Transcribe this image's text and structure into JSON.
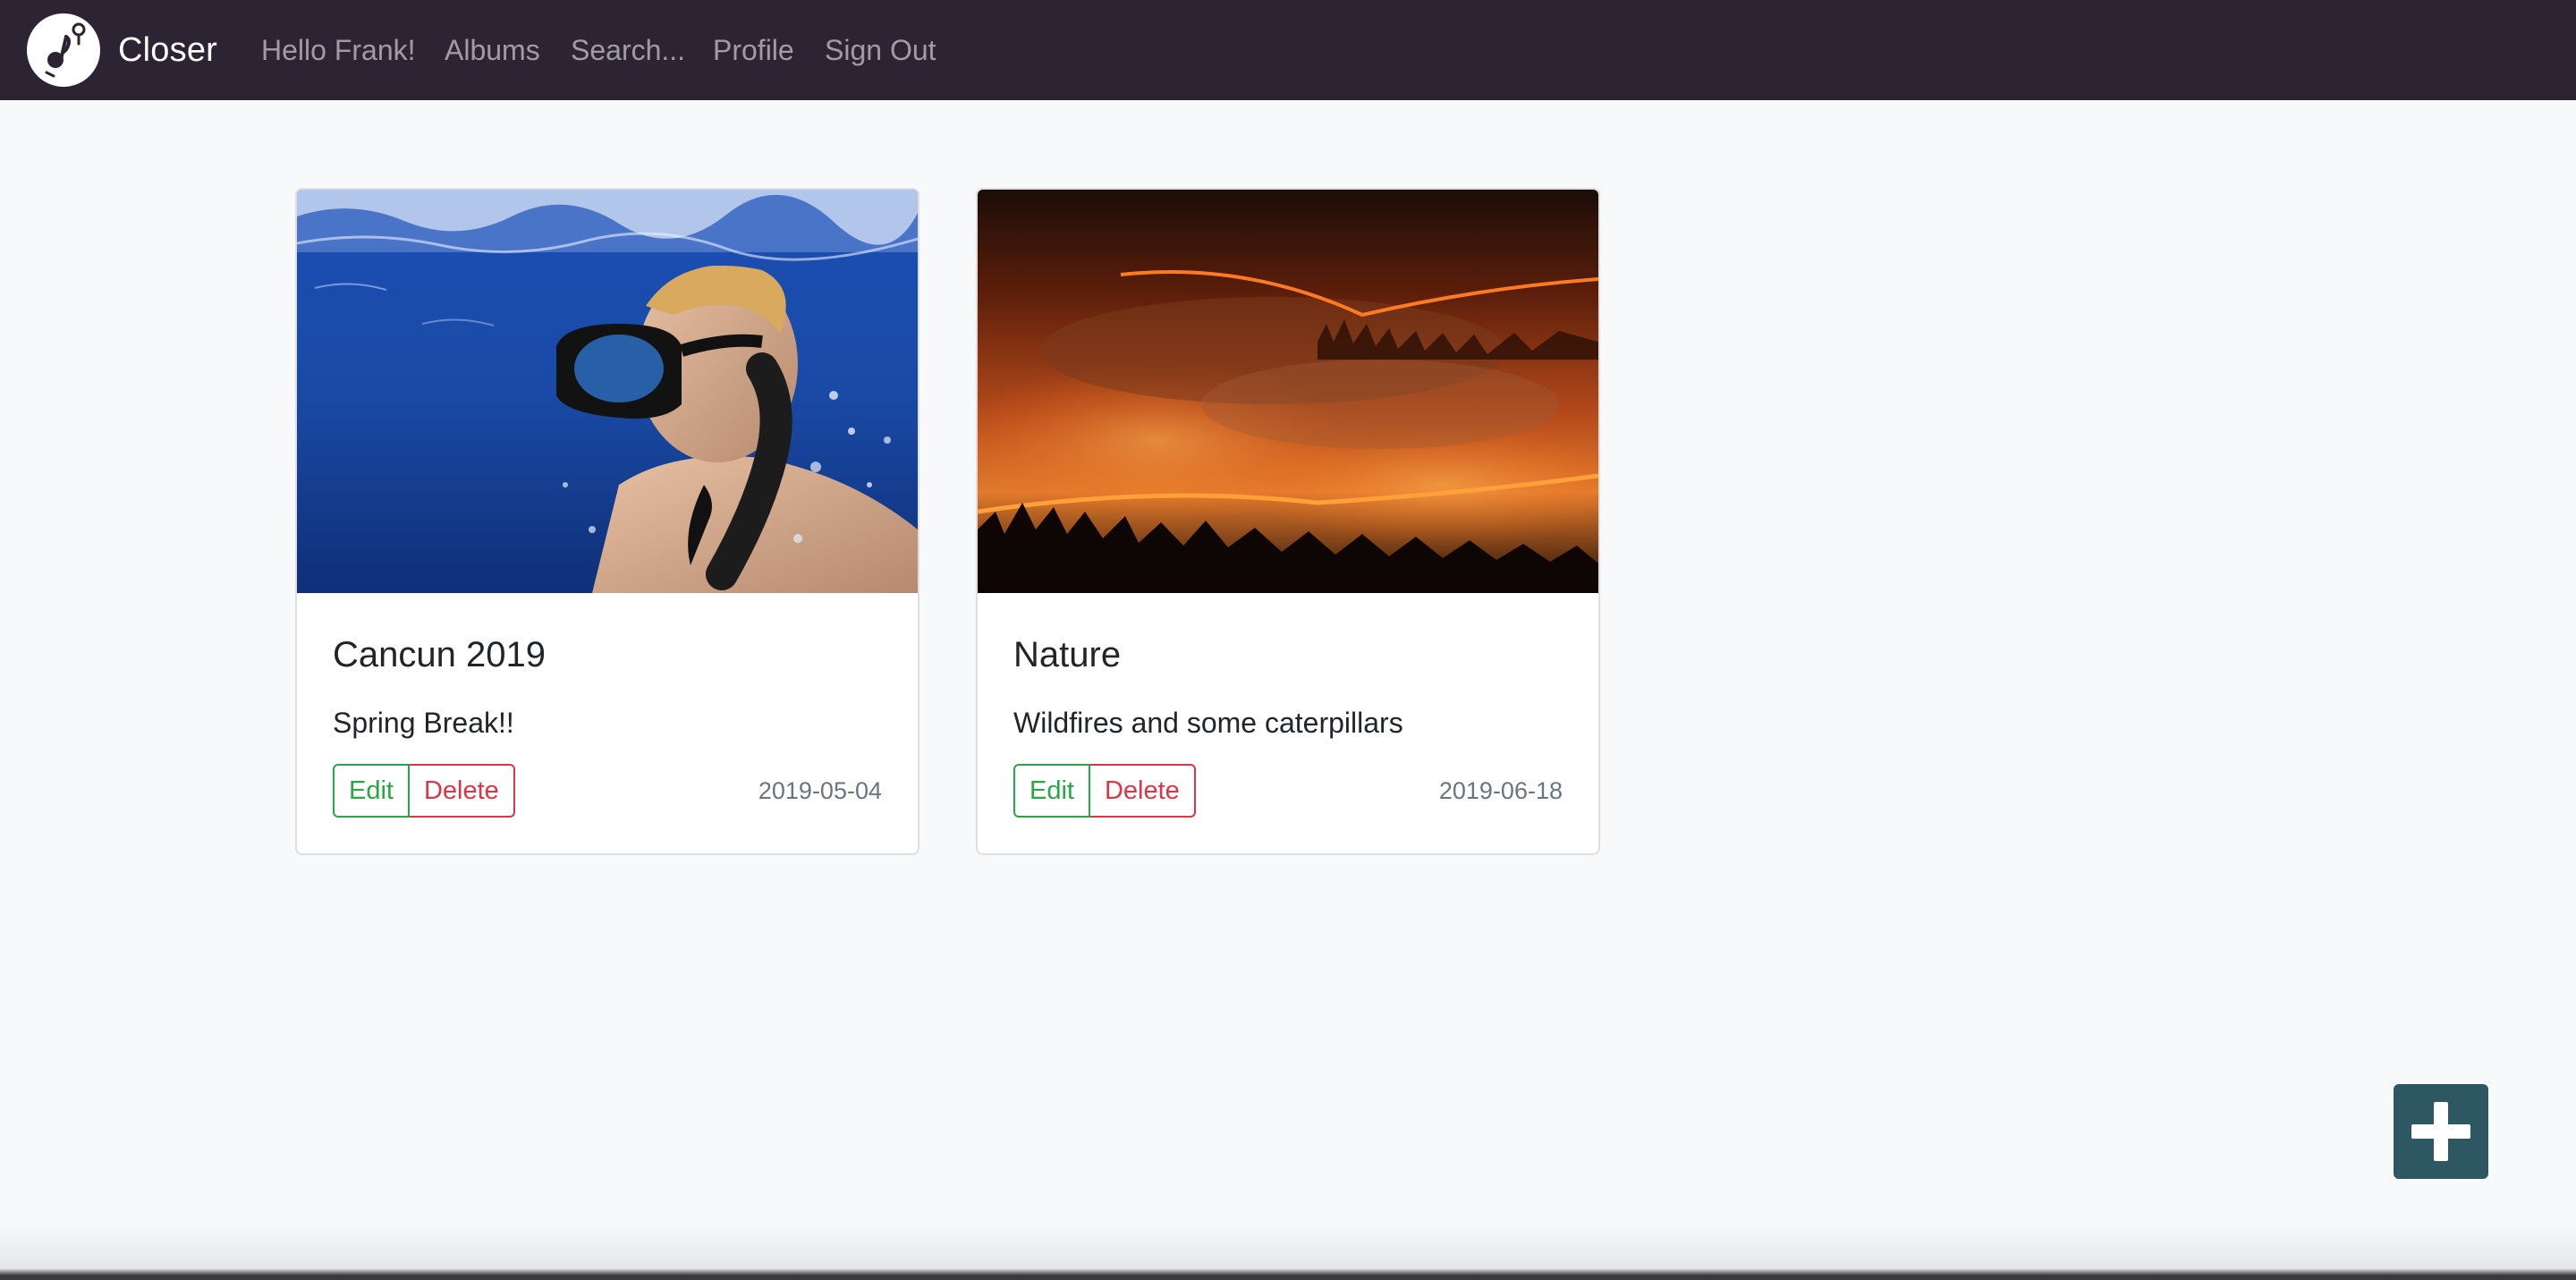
{
  "navbar": {
    "brand": "Closer",
    "logo_icon": "location-pin-music-note-icon",
    "links": {
      "hello": "Hello Frank!",
      "albums": "Albums",
      "search": "Search...",
      "profile": "Profile",
      "signout": "Sign Out"
    }
  },
  "albums": [
    {
      "title": "Cancun 2019",
      "description": "Spring Break!!",
      "date": "2019-05-04",
      "image": "snorkeler-underwater-photo",
      "edit_label": "Edit",
      "delete_label": "Delete"
    },
    {
      "title": "Nature",
      "description": "Wildfires and some caterpillars",
      "date": "2019-06-18",
      "image": "forest-wildfire-photo",
      "edit_label": "Edit",
      "delete_label": "Delete"
    }
  ],
  "fab": {
    "icon": "plus-icon"
  },
  "colors": {
    "navbar_bg": "#2d2433",
    "page_bg": "#f8f9fa",
    "edit_green": "#28a745",
    "delete_red": "#dc3545",
    "fab_bg": "#2c5763"
  }
}
